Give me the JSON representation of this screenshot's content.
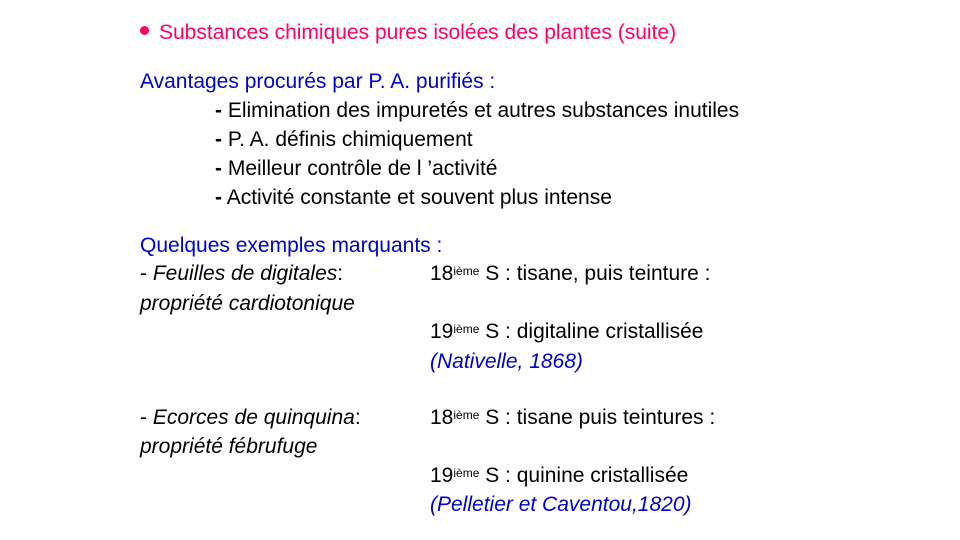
{
  "title": "Substances chimiques pures isolées des plantes (suite)",
  "advantages": {
    "heading": "Avantages procurés par P. A. purifiés :",
    "items": [
      "Elimination des impuretés et autres substances inutiles",
      "P. A. définis chimiquement",
      "Meilleur contrôle de l ’activité",
      "Activité constante et souvent plus intense"
    ],
    "dash": "-"
  },
  "examples": {
    "heading": "Quelques exemples marquants :",
    "digitale": {
      "prefix": "- ",
      "name": "Feuilles de digitales",
      "colon": ":",
      "property": "propriété cardiotonique",
      "c18_num": "18",
      "c18_sup": "ième",
      "c18_text": " S : tisane, puis teinture :",
      "c19_num": "19",
      "c19_sup": "ième",
      "c19_text": " S : digitaline cristallisée",
      "ref": "(Nativelle, 1868)"
    },
    "quinquina": {
      "prefix": "- ",
      "name": "Ecorces de quinquina",
      "colon": ":",
      "property": "propriété fébrufuge",
      "c18_num": "18",
      "c18_sup": "ième",
      "c18_text": " S : tisane puis teintures :",
      "c19_num": "19",
      "c19_sup": "ième",
      "c19_text": " S : quinine cristallisée",
      "ref": "(Pelletier et Caventou,1820)"
    }
  }
}
